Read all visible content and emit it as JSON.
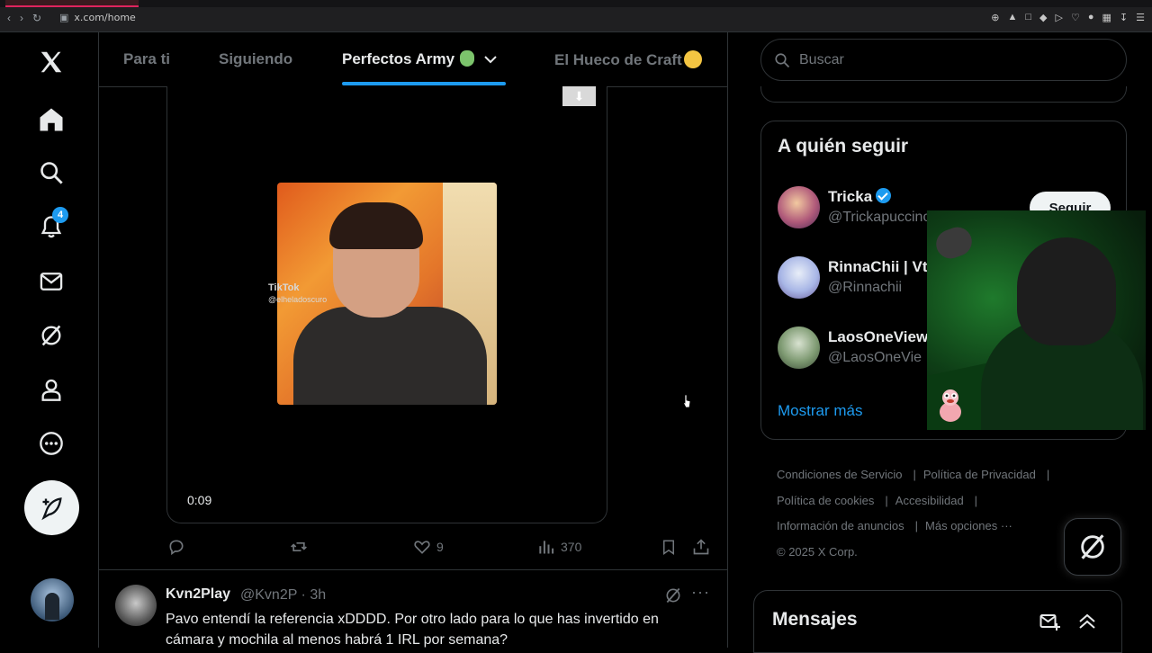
{
  "browser": {
    "url": "x.com/home",
    "nav_icons": [
      "back-icon",
      "forward-icon",
      "reload-icon"
    ],
    "extension_icons": [
      "zoom-icon",
      "pin-icon",
      "screenshot-icon",
      "shield-icon",
      "play-icon",
      "heart-icon",
      "extension-icon",
      "puzzle-icon",
      "download-icon",
      "menu-icon"
    ]
  },
  "sidebar": {
    "notifications_badge": "4",
    "items": [
      "x-logo-icon",
      "home-icon",
      "search-icon",
      "notifications-icon",
      "messages-icon",
      "grok-icon",
      "profile-icon",
      "more-icon"
    ]
  },
  "tabs": [
    {
      "label": "Para ti",
      "active": false
    },
    {
      "label": "Siguiendo",
      "active": false
    },
    {
      "label": "Perfectos Army",
      "active": true
    },
    {
      "label": "El Hueco de Craft",
      "active": false
    }
  ],
  "post": {
    "video": {
      "watermark": "TikTok",
      "watermark_handle": "@elheladoscuro",
      "timestamp": "0:09"
    },
    "actions": {
      "replies": "",
      "reposts": "",
      "likes": "9",
      "views": "370"
    }
  },
  "reply": {
    "name": "Kvn2Play",
    "handle": "@Kvn2P · 3h",
    "text": "Pavo entendí la referencia xDDDD. Por otro lado para lo que has invertido en cámara y mochila al menos habrá 1 IRL por semana?"
  },
  "right": {
    "search_placeholder": "Buscar",
    "who_to_follow": {
      "title": "A quién seguir",
      "accounts": [
        {
          "name": "Tricka",
          "handle": "@Trickapuccino",
          "verified": true
        },
        {
          "name": "RinnaChii | Vt",
          "handle": "@Rinnachii",
          "verified": false
        },
        {
          "name": "LaosOneView",
          "handle": "@LaosOneVie",
          "verified": false
        }
      ],
      "follow_label": "Seguir",
      "show_more": "Mostrar más"
    },
    "footer": {
      "links": [
        "Condiciones de Servicio",
        "Política de Privacidad",
        "Política de cookies",
        "Accesibilidad",
        "Información de anuncios",
        "Más opciones ···"
      ],
      "copyright": "© 2025 X Corp."
    },
    "messages_label": "Mensajes"
  }
}
